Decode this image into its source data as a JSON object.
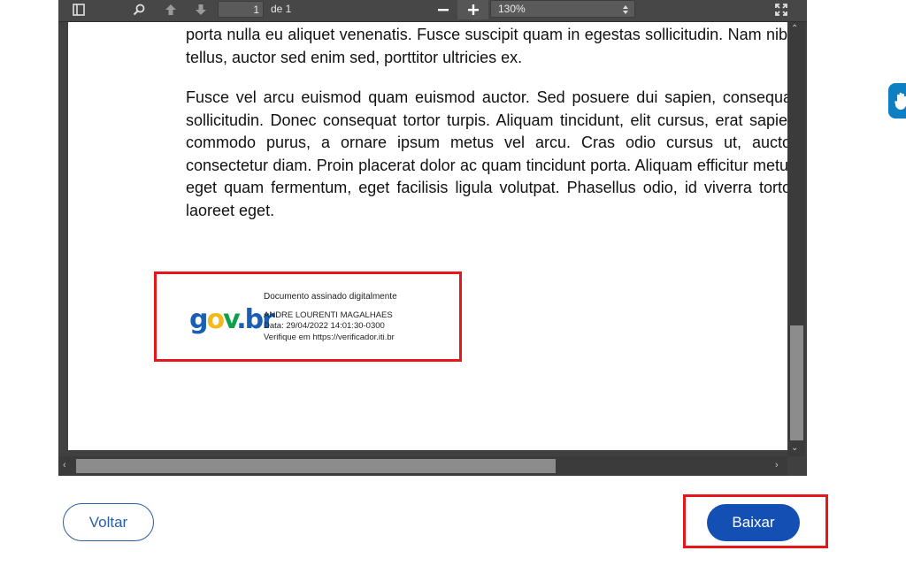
{
  "toolbar": {
    "page_number": "1",
    "page_of": "de 1",
    "zoom_value": "130%",
    "icons": [
      "sidebar-toggle-icon",
      "search-icon",
      "arrow-up-icon",
      "arrow-down-icon",
      "minus-icon",
      "plus-icon",
      "fullscreen-icon"
    ]
  },
  "document": {
    "paragraph1": "porta nulla eu aliquet venenatis. Fusce suscipit quam in egestas sollicitudin. Nam nibh tellus, auctor sed enim sed, porttitor ultricies ex.",
    "paragraph2": "Fusce vel arcu euismod quam euismod auctor. Sed posuere dui sapien, consequat sollicitudin. Donec consequat tortor turpis. Aliquam tincidunt, elit cursus, erat sapien commodo purus, a ornare ipsum metus vel arcu. Cras odio cursus ut, auctor consectetur diam. Proin placerat dolor ac quam tincidunt porta. Aliquam efficitur metus eget quam fermentum, eget facilisis ligula volutpat. Phasellus odio, id viverra tortor laoreet eget."
  },
  "signature": {
    "logo_parts": [
      "g",
      "o",
      "v",
      ".",
      "br"
    ],
    "title": "Documento assinado digitalmente",
    "signer": "ANDRE LOURENTI MAGALHAES",
    "date": "Data: 29/04/2022 14:01:30-0300",
    "verify": "Verifique em https://verificador.iti.br"
  },
  "actions": {
    "back_label": "Voltar",
    "download_label": "Baixar"
  },
  "colors": {
    "highlight": "#e8151b",
    "primary": "#1450b3",
    "viewer_bg": "#404040"
  }
}
